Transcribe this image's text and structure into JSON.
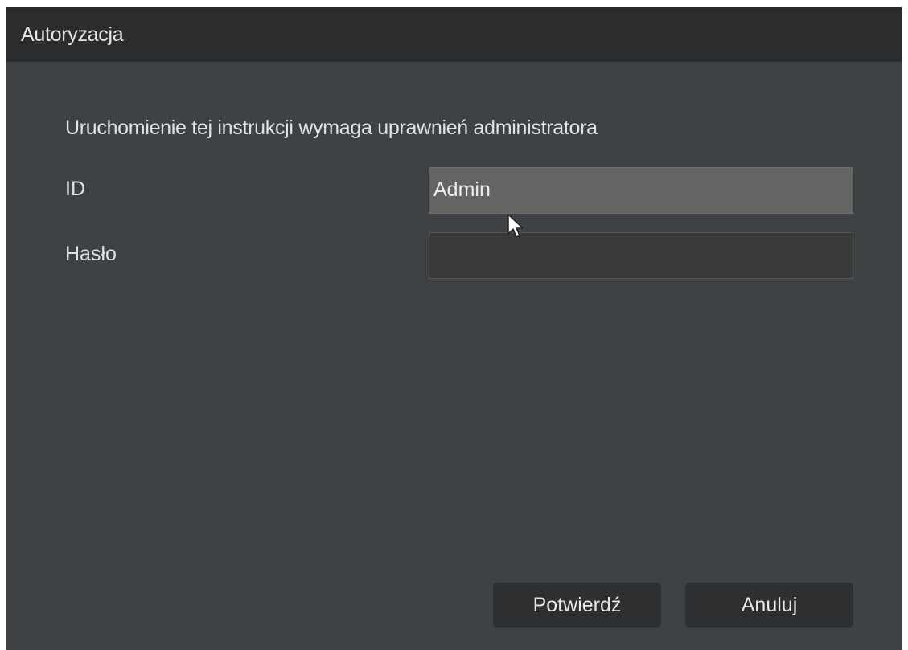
{
  "dialog": {
    "title": "Autoryzacja",
    "message": "Uruchomienie tej instrukcji wymaga uprawnień administratora",
    "fields": {
      "id_label": "ID",
      "id_value": "Admin",
      "password_label": "Hasło",
      "password_value": ""
    },
    "buttons": {
      "confirm_label": "Potwierdź",
      "cancel_label": "Anuluj"
    }
  },
  "icons": {
    "cursor": "mouse-pointer-icon"
  },
  "colors": {
    "dialog_bg": "#3f4244",
    "titlebar_bg": "#2b2c2e",
    "id_field_bg": "#646462",
    "password_field_bg": "#3a3a38",
    "button_bg": "#2e2f31",
    "text": "#e2e2e2"
  }
}
